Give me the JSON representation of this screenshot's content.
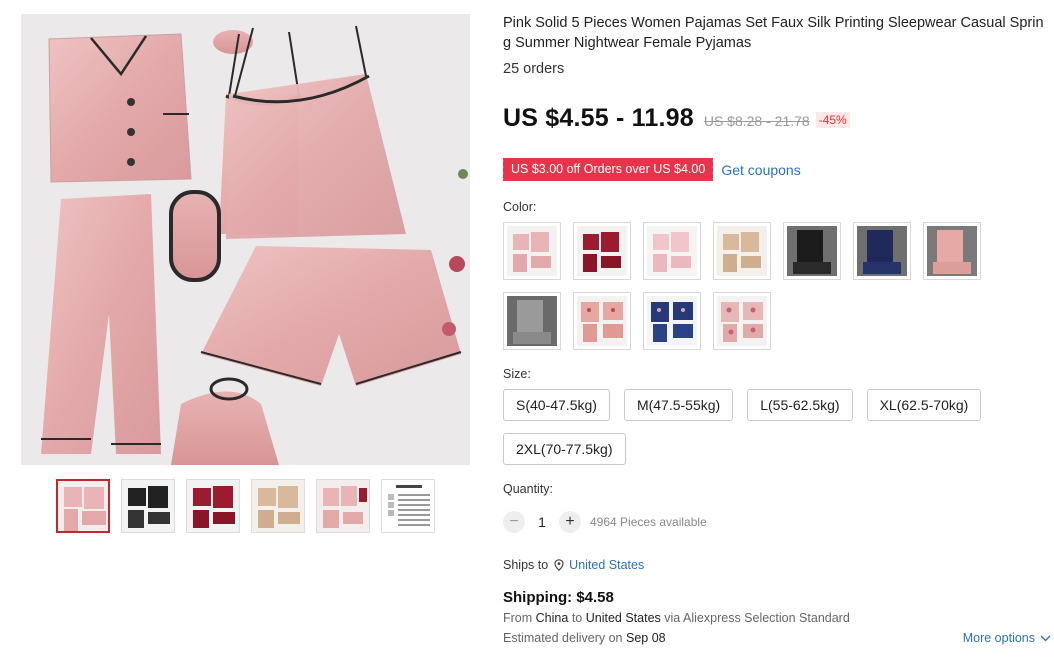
{
  "product": {
    "title": "Pink Solid 5 Pieces Women Pajamas Set Faux Silk Printing Sleepwear Casual Spring Summer Nightwear Female Pyjamas",
    "orders": "25 orders",
    "price": "US $4.55 - 11.98",
    "original_price": "US $8.28 - 21.78",
    "discount": "-45%"
  },
  "coupon": {
    "text": "US $3.00 off Orders over US $4.00",
    "link": "Get coupons"
  },
  "color": {
    "label": "Color:",
    "options": [
      {
        "name": "pink",
        "tone": "#e8b4b8"
      },
      {
        "name": "black",
        "tone": "#222222"
      },
      {
        "name": "wine-red",
        "tone": "#9b1b30"
      },
      {
        "name": "light-pink",
        "tone": "#f0c6cc"
      },
      {
        "name": "champagne",
        "tone": "#d9b99b"
      },
      {
        "name": "black-lace",
        "tone": "#2a2a2a"
      },
      {
        "name": "navy-lace",
        "tone": "#1f2a5a"
      },
      {
        "name": "pink-lace",
        "tone": "#e7a9a5"
      },
      {
        "name": "gray",
        "tone": "#8a8a8a"
      },
      {
        "name": "pink-print",
        "tone": "#e6a7a2"
      },
      {
        "name": "navy-print",
        "tone": "#263a78"
      },
      {
        "name": "floral-print",
        "tone": "#c8606c"
      }
    ]
  },
  "size": {
    "label": "Size:",
    "options": [
      "S(40-47.5kg)",
      "M(47.5-55kg)",
      "L(55-62.5kg)",
      "XL(62.5-70kg)",
      "2XL(70-77.5kg)"
    ]
  },
  "quantity": {
    "label": "Quantity:",
    "value": "1",
    "minus": "−",
    "plus": "+",
    "available": "4964 Pieces available"
  },
  "shipping": {
    "ships_to_label": "Ships to",
    "country": "United States",
    "cost": "Shipping: $4.58",
    "from_prefix": "From",
    "from": "China",
    "to_word": "to",
    "to": "United States",
    "via": "via Aliexpress Selection Standard",
    "estimated_prefix": "Estimated delivery on",
    "estimated_date": "Sep 08",
    "more_options": "More options"
  },
  "gallery": {
    "thumbnails": [
      {
        "name": "pink",
        "tone": "#e8b4b8",
        "active": true
      },
      {
        "name": "black",
        "tone": "#222222",
        "active": false
      },
      {
        "name": "wine-red",
        "tone": "#9b1b30",
        "active": false
      },
      {
        "name": "champagne",
        "tone": "#d9b99b",
        "active": false
      },
      {
        "name": "pink-burgundy",
        "tone": "#e8b4b8",
        "active": false
      },
      {
        "name": "size-chart",
        "tone": "#ffffff",
        "active": false
      }
    ]
  }
}
